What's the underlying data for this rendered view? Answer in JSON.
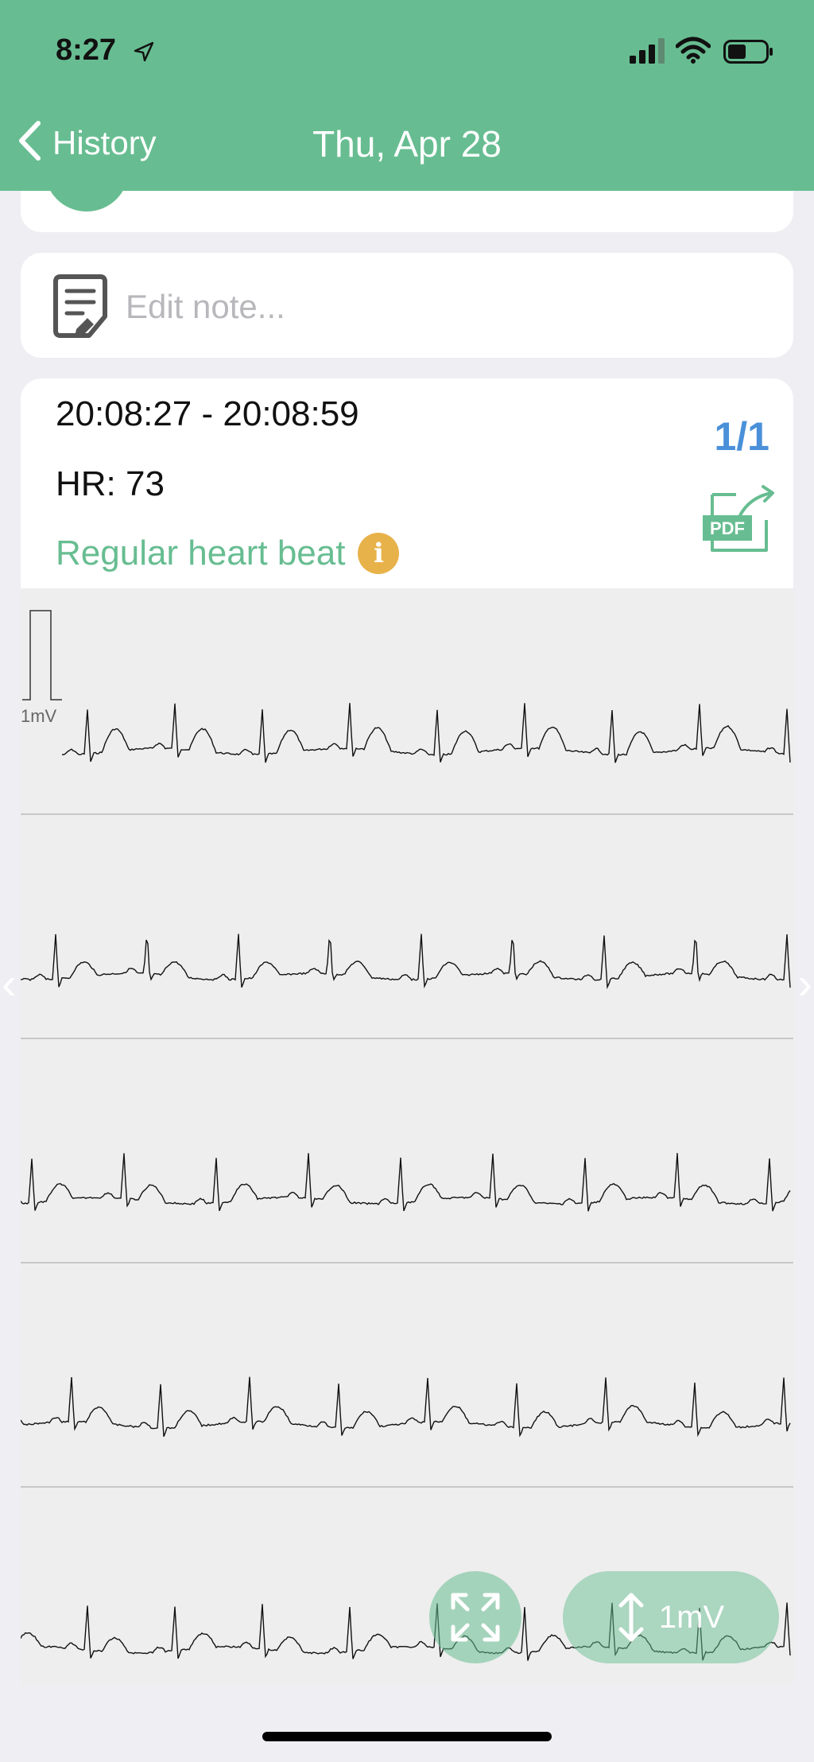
{
  "status_bar": {
    "time": "8:27"
  },
  "nav": {
    "back_label": "History",
    "title": "Thu, Apr 28"
  },
  "note": {
    "placeholder": "Edit note..."
  },
  "record": {
    "time_range": "20:08:27 - 20:08:59",
    "heart_rate": "HR: 73",
    "result": "Regular heart beat",
    "page_indicator": "1/1"
  },
  "ecg": {
    "calibration_label": "1mV",
    "strips": 5,
    "trace_color": "#111111"
  },
  "controls": {
    "scale_label": "1mV"
  },
  "colors": {
    "brand": "#67bd91",
    "accent_info": "#e8b24a",
    "page_indicator": "#4a90d9"
  }
}
